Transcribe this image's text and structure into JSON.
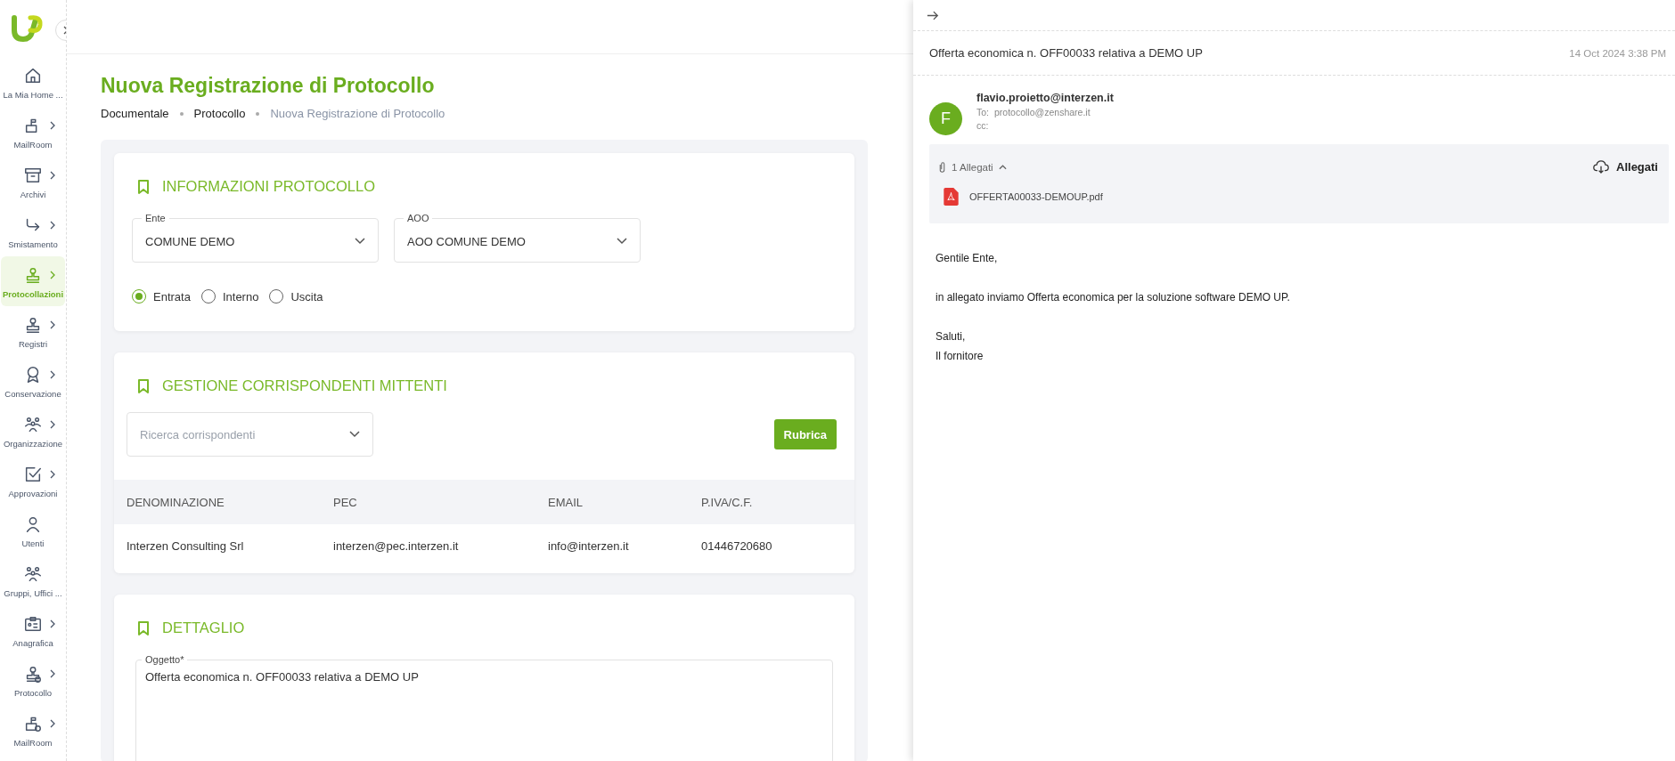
{
  "sidebar": {
    "items": [
      {
        "kind": "home",
        "label": "La Mia Home ...",
        "chevron": false,
        "selected": false
      },
      {
        "kind": "mailbox",
        "label": "MailRoom",
        "chevron": true,
        "selected": false
      },
      {
        "kind": "archive",
        "label": "Archivi",
        "chevron": true,
        "selected": false
      },
      {
        "kind": "forward",
        "label": "Smistamento",
        "chevron": true,
        "selected": false
      },
      {
        "kind": "stamp",
        "label": "Protocollazioni",
        "chevron": true,
        "selected": true
      },
      {
        "kind": "stamp",
        "label": "Registri",
        "chevron": true,
        "selected": false
      },
      {
        "kind": "award",
        "label": "Conservazione",
        "chevron": true,
        "selected": false
      },
      {
        "kind": "people",
        "label": "Organizzazione",
        "chevron": true,
        "selected": false
      },
      {
        "kind": "check",
        "label": "Approvazioni",
        "chevron": true,
        "selected": false
      },
      {
        "kind": "user",
        "label": "Utenti",
        "chevron": false,
        "selected": false
      },
      {
        "kind": "people",
        "label": "Gruppi, Uffici ...",
        "chevron": false,
        "selected": false
      },
      {
        "kind": "idcard",
        "label": "Anagrafica",
        "chevron": true,
        "selected": false
      },
      {
        "kind": "stampgear",
        "label": "Protocollo",
        "chevron": true,
        "selected": false
      },
      {
        "kind": "mailgear",
        "label": "MailRoom",
        "chevron": true,
        "selected": false
      }
    ]
  },
  "page": {
    "title": "Nuova Registrazione di Protocollo",
    "breadcrumb": [
      "Documentale",
      "Protocollo",
      "Nuova Registrazione di Protocollo"
    ]
  },
  "info_card": {
    "title": "INFORMAZIONI PROTOCOLLO",
    "selects": [
      {
        "label": "Ente",
        "value": "COMUNE DEMO"
      },
      {
        "label": "AOO",
        "value": "AOO COMUNE DEMO"
      }
    ],
    "direction": [
      {
        "label": "Entrata",
        "selected": true
      },
      {
        "label": "Interno",
        "selected": false
      },
      {
        "label": "Uscita",
        "selected": false
      }
    ]
  },
  "corr_card": {
    "title": "GESTIONE CORRISPONDENTI MITTENTI",
    "search": {
      "placeholder": "Ricerca corrispondenti"
    },
    "button": "Rubrica",
    "table": {
      "columns": [
        "DENOMINAZIONE",
        "PEC",
        "EMAIL",
        "P.IVA/C.F."
      ],
      "rows": [
        [
          "Interzen Consulting Srl",
          "interzen@pec.interzen.it",
          "info@interzen.it",
          "01446720680"
        ]
      ]
    }
  },
  "detail_card": {
    "title": "DETTAGLIO",
    "field": {
      "label": "Oggetto*",
      "value": "Offerta economica n. OFF00033 relativa a DEMO UP"
    }
  },
  "email": {
    "subject": "Offerta economica n. OFF00033 relativa a DEMO UP",
    "date": "14 Oct 2024 3:38 PM",
    "avatar": "F",
    "from": "flavio.proietto@interzen.it",
    "to_label": "To:",
    "to": "protocollo@zenshare.it",
    "cc_label": "cc:",
    "attachments": {
      "count": "1 Allegati",
      "expanded": true,
      "download": "Allegati",
      "files": [
        "OFFERTA00033-DEMOUP.pdf"
      ]
    },
    "body": [
      "Gentile Ente,",
      "in allegato inviamo Offerta economica per la soluzione software DEMO UP.",
      "Saluti,",
      "Il fornitore"
    ]
  }
}
